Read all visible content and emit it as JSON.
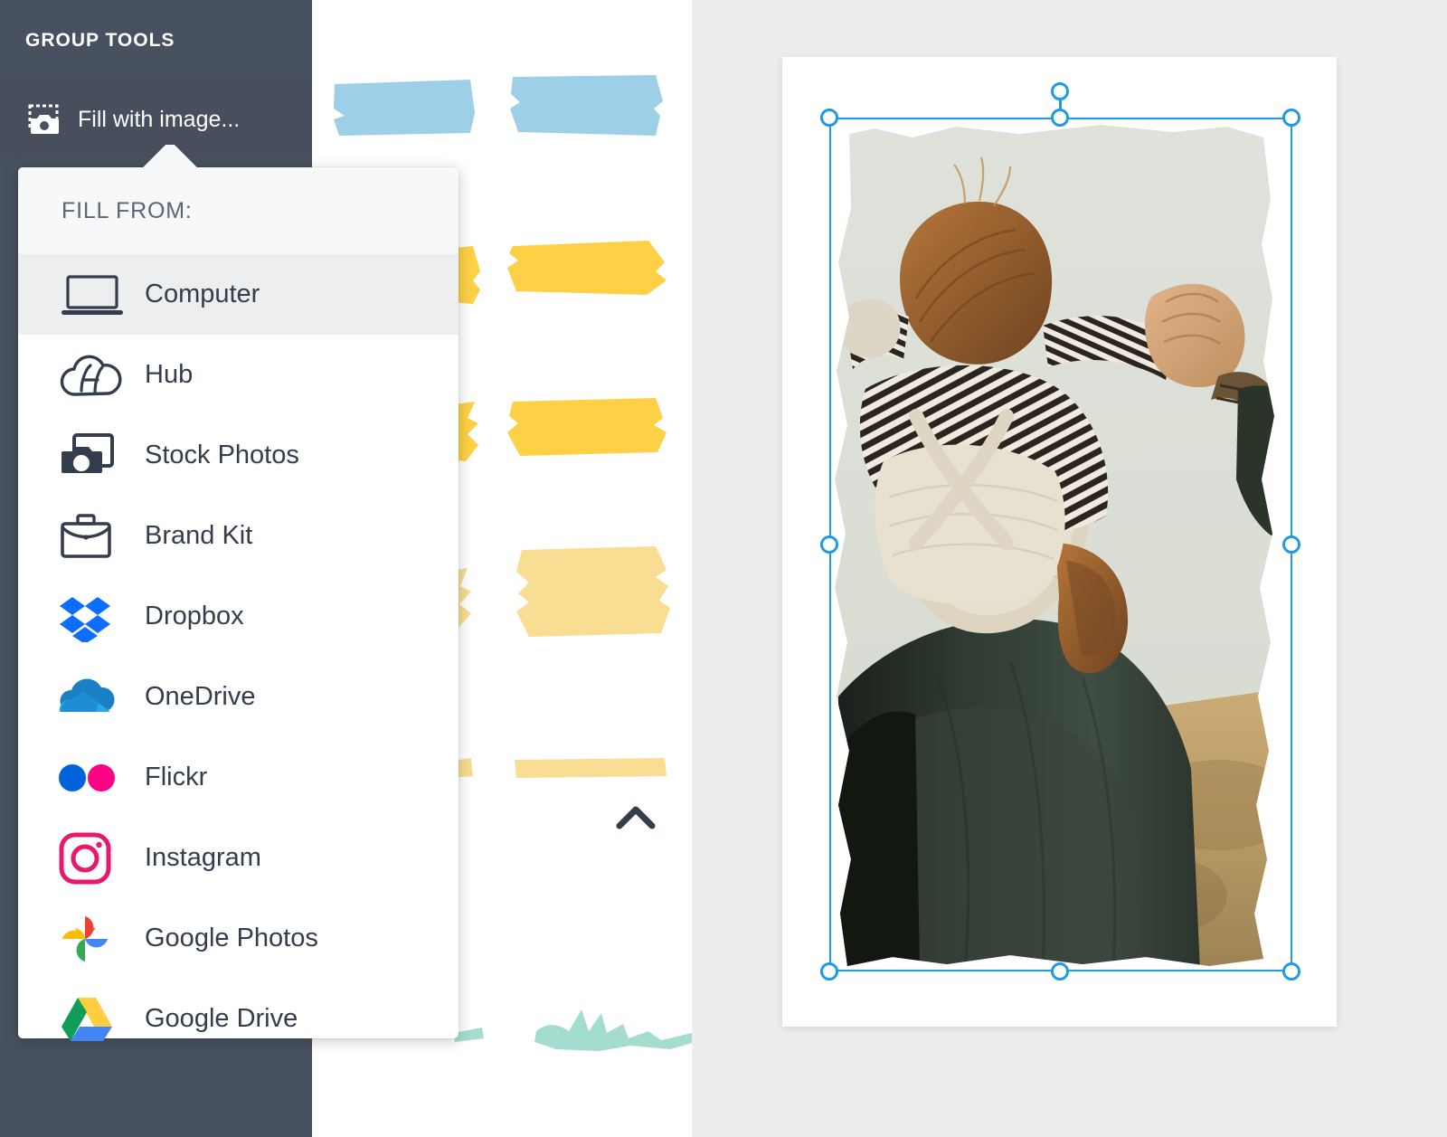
{
  "sidebar": {
    "header_label": "GROUP TOOLS",
    "background_color": "#48515f",
    "items": [
      {
        "label": "Fill with image...",
        "icon": "fill-with-image-icon",
        "active": true
      }
    ]
  },
  "flyout": {
    "title": "FILL FROM:",
    "background_color": "#ffffff",
    "header_background_color": "#f7f8f9",
    "selected_item": "Computer",
    "items": [
      {
        "label": "Computer",
        "icon": "laptop-icon",
        "selected": true
      },
      {
        "label": "Hub",
        "icon": "hub-cloud-icon",
        "selected": false
      },
      {
        "label": "Stock Photos",
        "icon": "stock-photos-icon",
        "selected": false
      },
      {
        "label": "Brand Kit",
        "icon": "briefcase-icon",
        "selected": false
      },
      {
        "label": "Dropbox",
        "icon": "dropbox-icon",
        "selected": false
      },
      {
        "label": "OneDrive",
        "icon": "onedrive-icon",
        "selected": false
      },
      {
        "label": "Flickr",
        "icon": "flickr-icon",
        "selected": false
      },
      {
        "label": "Instagram",
        "icon": "instagram-icon",
        "selected": false
      },
      {
        "label": "Google Photos",
        "icon": "google-photos-icon",
        "selected": false
      },
      {
        "label": "Google Drive",
        "icon": "google-drive-icon",
        "selected": false
      }
    ]
  },
  "canvas": {
    "selection_color": "#1e9ae8",
    "page_background": "#ffffff",
    "workspace_background": "#eceded",
    "stroke_colors": {
      "blue": "#9ecfe8",
      "yellow": "#fdd046",
      "pale_yellow": "#f8dd92",
      "teal": "#a4ddd0"
    },
    "selected_object": "image-placeholder",
    "collapse_control": "chevron-up-icon"
  }
}
